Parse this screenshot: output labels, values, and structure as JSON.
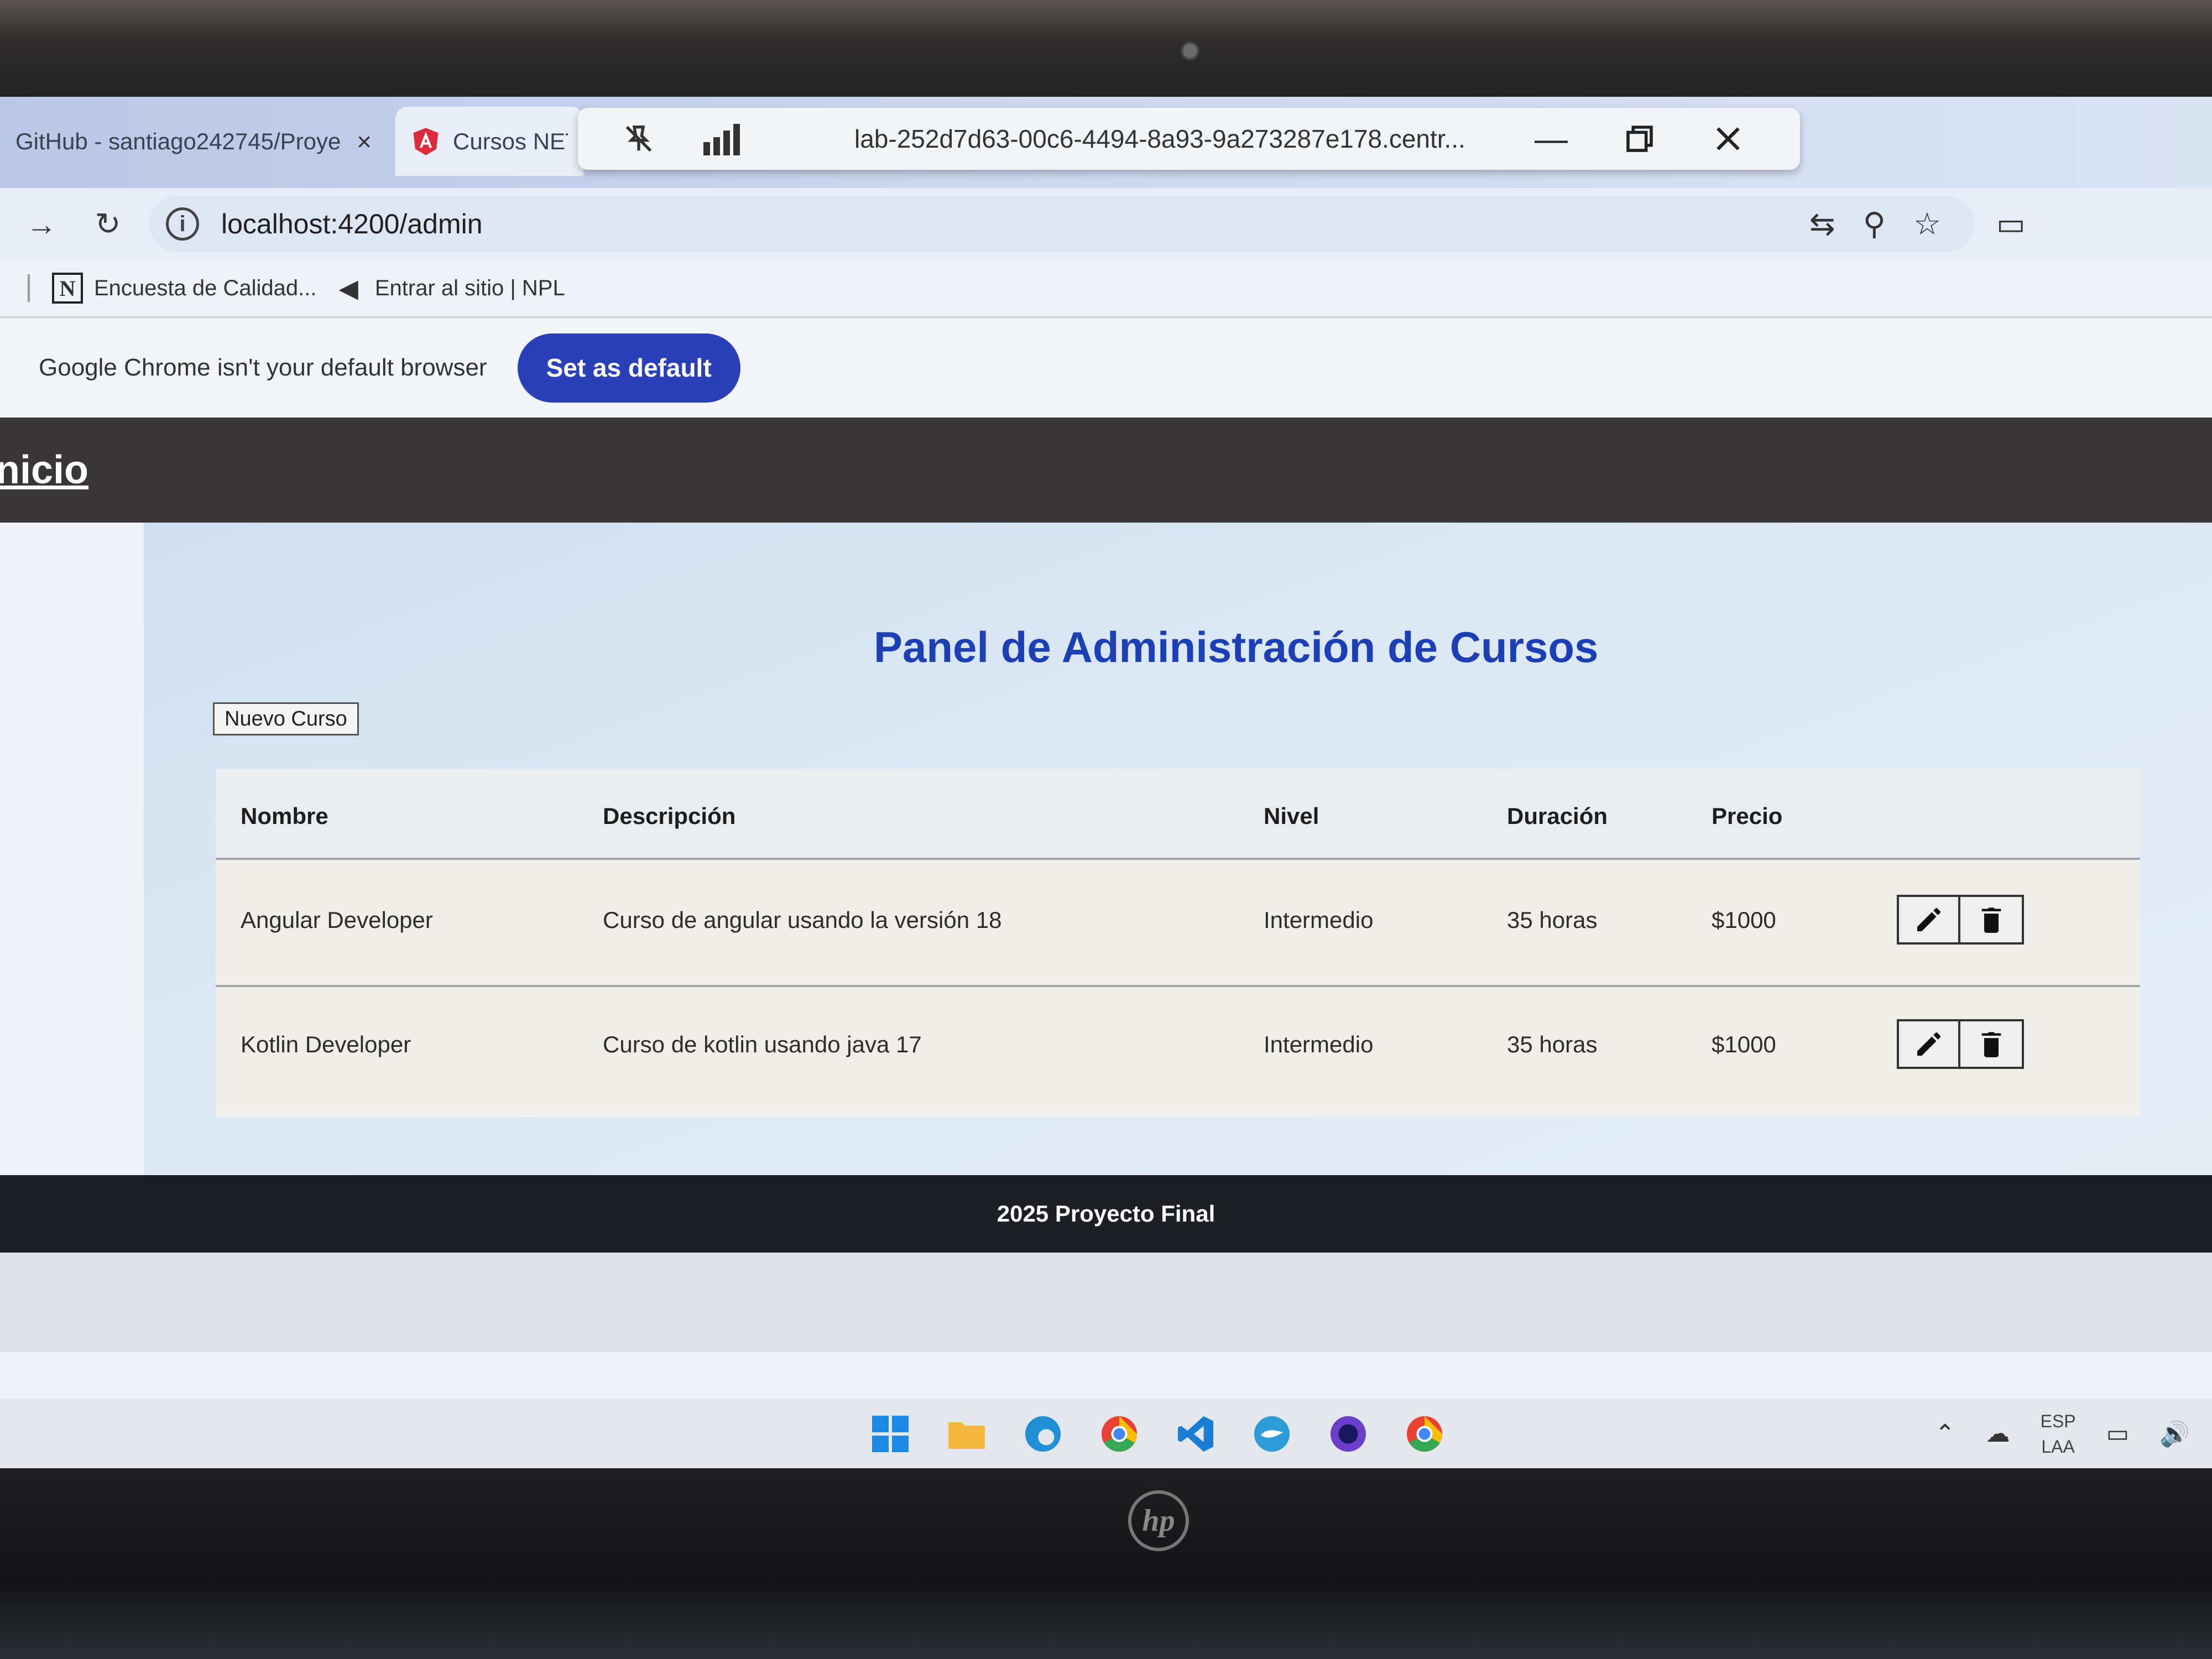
{
  "browser": {
    "tabs": [
      {
        "label": "GitHub - santiago242745/Proye",
        "close": "×"
      },
      {
        "label": "Cursos NETE"
      }
    ],
    "remote_session_title": "lab-252d7d63-00c6-4494-8a93-9a273287e178.centr...",
    "url": "localhost:4200/admin",
    "bookmarks": [
      {
        "label": "Encuesta de Calidad...",
        "icon": "notion-icon"
      },
      {
        "label": "Entrar al sitio | NPL",
        "icon": "npl-icon"
      }
    ],
    "infobar": {
      "message": "Google Chrome isn't your default browser",
      "button": "Set as default"
    }
  },
  "app": {
    "nav_link": "Inicio",
    "title": "Panel de Administración de Cursos",
    "new_button": "Nuevo Curso",
    "columns": [
      "Nombre",
      "Descripción",
      "Nivel",
      "Duración",
      "Precio"
    ],
    "rows": [
      {
        "nombre": "Angular Developer",
        "descripcion": "Curso de angular usando la versión 18",
        "nivel": "Intermedio",
        "duracion": "35 horas",
        "precio": "$1000"
      },
      {
        "nombre": "Kotlin Developer",
        "descripcion": "Curso de kotlin usando java 17",
        "nivel": "Intermedio",
        "duracion": "35 horas",
        "precio": "$1000"
      }
    ],
    "footer": "2025 Proyecto Final"
  },
  "taskbar": {
    "language": "ESP",
    "layout": "LAA"
  },
  "colors": {
    "title": "#1c3fb6",
    "primary_button": "#2b3fb8",
    "nav_bg": "#3a3536",
    "footer_bg": "#1d1f24"
  }
}
